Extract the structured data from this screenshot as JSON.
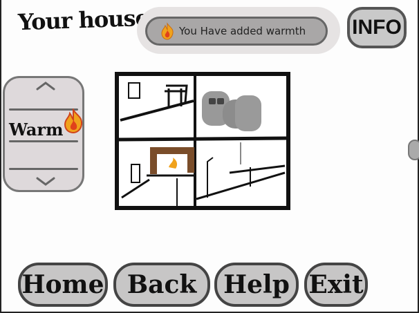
{
  "header": {
    "title": "Your house"
  },
  "notification": {
    "icon": "fire-icon",
    "text": "You Have added warmth"
  },
  "info_button": {
    "label": "INFO"
  },
  "mode_selector": {
    "selected_label": "Warm",
    "selected_icon": "fire-icon",
    "up_icon": "chevron-up-icon",
    "down_icon": "chevron-down-icon"
  },
  "bottom_nav": {
    "home": "Home",
    "back": "Back",
    "help": "Help",
    "exit": "Exit"
  },
  "colors": {
    "fire_outer": "#f0a21c",
    "fire_inner": "#e0421b",
    "fireplace_brown": "#7a4d2a",
    "panel_gray": "#c7c6c6"
  }
}
